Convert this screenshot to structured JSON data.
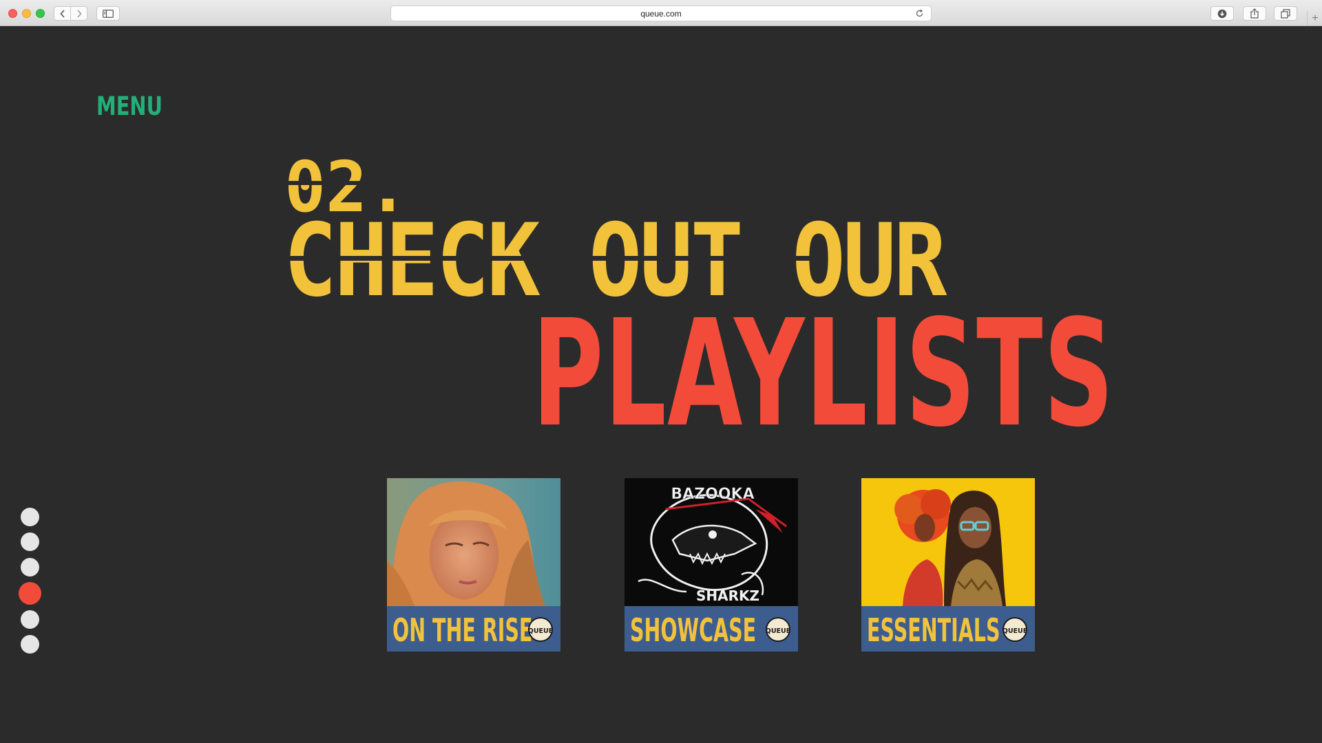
{
  "browser": {
    "url": "queue.com"
  },
  "nav": {
    "menu_label": "MENU"
  },
  "hero": {
    "number": "02.",
    "headline": "CHECK OUT OUR",
    "highlight": "PLAYLISTS"
  },
  "section_dots": {
    "count": 6,
    "active_index": 3
  },
  "playlists": [
    {
      "title": "ON THE RISE",
      "badge": "QUEUE"
    },
    {
      "title": "SHOWCASE",
      "badge": "QUEUE",
      "art_text_top": "BAZOOKA",
      "art_text_bottom": "SHARKZ"
    },
    {
      "title": "ESSENTIALS",
      "badge": "QUEUE"
    }
  ],
  "colors": {
    "background": "#2b2b2b",
    "menu_green": "#22b07a",
    "headline_yellow": "#f2c23a",
    "highlight_red": "#f24b3a",
    "card_bar_blue": "#3e5d8f",
    "dot_inactive": "#e6e6e6"
  }
}
